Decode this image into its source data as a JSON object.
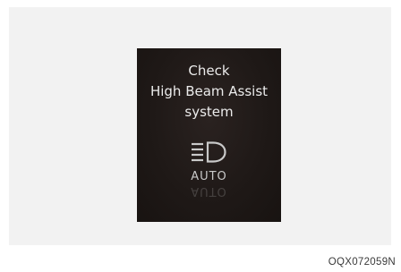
{
  "display": {
    "message_lines": [
      "Check",
      "High Beam Assist",
      "system"
    ],
    "indicator_icon": "high-beam-assist-icon",
    "indicator_label": "AUTO"
  },
  "figure_code": "OQX072059N",
  "colors": {
    "panel_background": "#f2f2f2",
    "display_background": "#1f1917",
    "message_text": "#ebebeb",
    "icon_and_label": "#c9c9c9"
  }
}
